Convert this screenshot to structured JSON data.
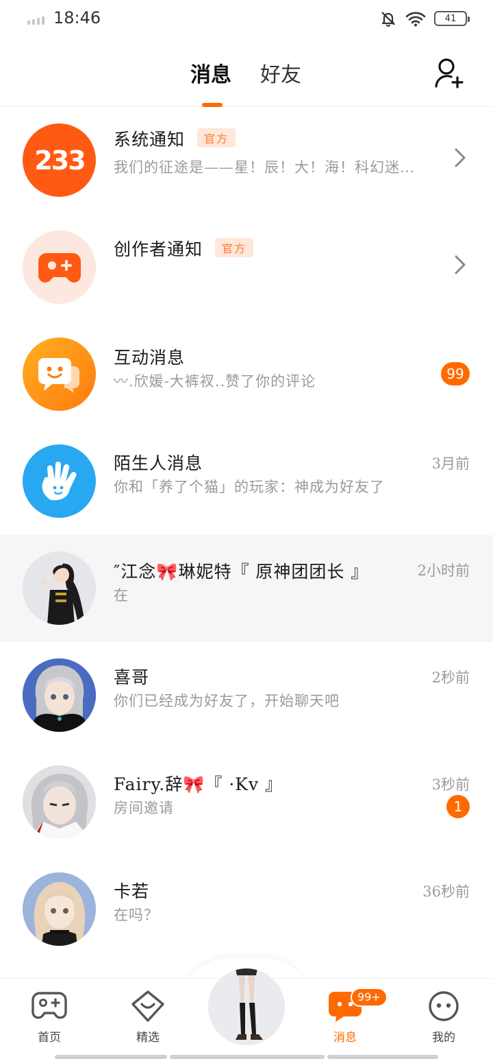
{
  "status": {
    "time": "18:46",
    "battery": "41",
    "icons": [
      "signal-icon",
      "mute-bell-icon",
      "wifi-icon",
      "battery-icon"
    ]
  },
  "header": {
    "tabs": [
      {
        "label": "消息",
        "active": true
      },
      {
        "label": "好友",
        "active": false
      }
    ],
    "add_friend_icon": "add-user-icon"
  },
  "conversations": [
    {
      "name": "系统通知",
      "tag": "官方",
      "preview": "我们的征途是——星！辰！大！海！科幻迷…",
      "time": "",
      "badge": "",
      "avatar": "233-logo"
    },
    {
      "name": "创作者通知",
      "tag": "官方",
      "preview": "",
      "time": "",
      "badge": "",
      "avatar": "gamepad-icon"
    },
    {
      "name": "互动消息",
      "tag": "",
      "preview": "〰.欣媛-大裤衩..赞了你的评论",
      "time": "",
      "badge": "99",
      "avatar": "chat-bubble-icon"
    },
    {
      "name": "陌生人消息",
      "tag": "",
      "preview": "你和「养了个猫」的玩家：神成为好友了",
      "time": "3月前",
      "badge": "",
      "avatar": "hand-icon"
    },
    {
      "name": "″江念🎀琳妮特『 原神团团长 』",
      "tag": "",
      "preview": "在",
      "time": "2小时前",
      "badge": "",
      "avatar": "character-avatar"
    },
    {
      "name": "喜哥",
      "tag": "",
      "preview": "你们已经成为好友了，开始聊天吧",
      "time": "2秒前",
      "badge": "",
      "avatar": "character-avatar"
    },
    {
      "name": "Fairy.辞🎀『 ·Kv 』",
      "tag": "",
      "preview": "房间邀请",
      "time": "3秒前",
      "badge": "1",
      "avatar": "character-avatar"
    },
    {
      "name": "卡若",
      "tag": "",
      "preview": "在吗？",
      "time": "36秒前",
      "badge": "",
      "avatar": "character-avatar"
    }
  ],
  "bottom_nav": {
    "items": [
      {
        "label": "首页",
        "icon": "gamepad-icon",
        "active": false
      },
      {
        "label": "精选",
        "icon": "heart-box-icon",
        "active": false
      },
      {
        "label": "消息",
        "icon": "message-icon",
        "active": true
      },
      {
        "label": "我的",
        "icon": "face-icon",
        "active": false
      }
    ],
    "message_badge": "99+"
  },
  "colors": {
    "accent": "#ff6a00",
    "tag_bg": "#ffe7d9",
    "tag_text": "#ff7a2e",
    "muted_text": "#9a9a9a",
    "highlight_row": "#f6f6f7"
  }
}
